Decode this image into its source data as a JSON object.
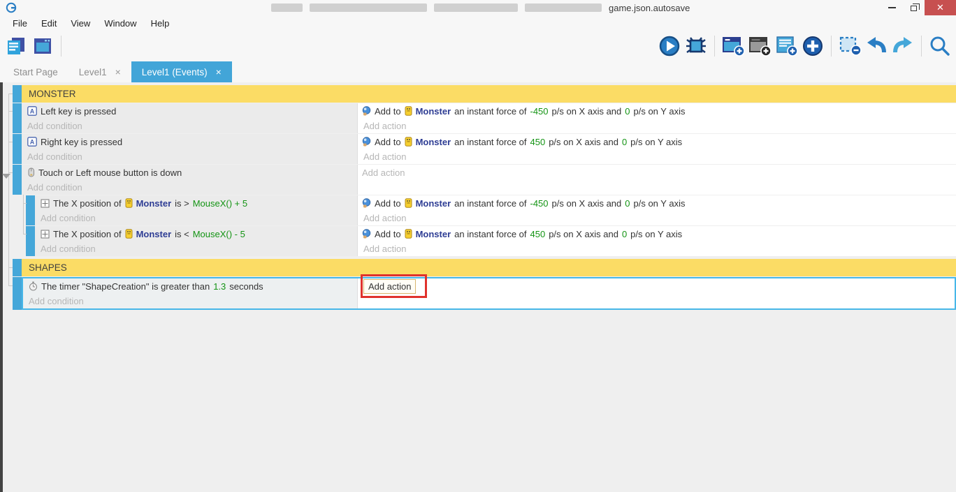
{
  "window": {
    "title": "game.json.autosave",
    "controls": {
      "minimize_glyph": "",
      "close_glyph": "✕"
    }
  },
  "menu": {
    "items": [
      "File",
      "Edit",
      "View",
      "Window",
      "Help"
    ]
  },
  "toolbar": {
    "left_icons": [
      "project-manager-icon",
      "scene-editor-icon"
    ],
    "right_icons": [
      "play-icon",
      "debug-icon",
      "add-event-icon",
      "add-subevent-icon",
      "add-comment-icon",
      "add-circle-icon",
      "remove-event-icon",
      "undo-icon",
      "redo-icon",
      "search-icon"
    ]
  },
  "tabs": {
    "items": [
      {
        "label": "Start Page",
        "active": false,
        "closable": false
      },
      {
        "label": "Level1",
        "active": false,
        "closable": true
      },
      {
        "label": "Level1 (Events)",
        "active": true,
        "closable": true
      }
    ],
    "close_glyph": "×"
  },
  "placeholders": {
    "condition": "Add condition",
    "action": "Add action"
  },
  "colors": {
    "accent_blue": "#42a5d8",
    "event_bar_blue": "#45a7d9",
    "group_yellow": "#fbdc65",
    "expression_green": "#149414",
    "object_navy": "#2e3d94",
    "annotation_red": "#e0322c",
    "close_button_red": "#c75050",
    "selected_border": "#47b7e8"
  },
  "events": {
    "group_monster": "MONSTER",
    "group_shapes": "SHAPES",
    "e1": {
      "cond": "Left key is pressed",
      "act_pre": "Add to",
      "act_obj": "Monster",
      "act_mid": "an instant force of",
      "act_v1": "-450",
      "act_mid2": "p/s on X axis and",
      "act_v2": "0",
      "act_suf": "p/s on Y axis"
    },
    "e2": {
      "cond": "Right key is pressed",
      "act_pre": "Add to",
      "act_obj": "Monster",
      "act_mid": "an instant force of",
      "act_v1": "450",
      "act_mid2": "p/s on X axis and",
      "act_v2": "0",
      "act_suf": "p/s on Y axis"
    },
    "e3": {
      "cond": "Touch or Left mouse button is down"
    },
    "s1": {
      "cond_pre": "The X position of",
      "cond_obj": "Monster",
      "cond_mid": "is >",
      "cond_expr": "MouseX() + 5",
      "act_pre": "Add to",
      "act_obj": "Monster",
      "act_mid": "an instant force of",
      "act_v1": "-450",
      "act_mid2": "p/s on X axis and",
      "act_v2": "0",
      "act_suf": "p/s on Y axis"
    },
    "s2": {
      "cond_pre": "The X position of",
      "cond_obj": "Monster",
      "cond_mid": "is <",
      "cond_expr": "MouseX() - 5",
      "act_pre": "Add to",
      "act_obj": "Monster",
      "act_mid": "an instant force of",
      "act_v1": "450",
      "act_mid2": "p/s on X axis and",
      "act_v2": "0",
      "act_suf": "p/s on Y axis"
    },
    "t1": {
      "cond_pre": "The timer \"ShapeCreation\" is greater than",
      "cond_v": "1.3",
      "cond_suf": "seconds",
      "act_focus": "Add action"
    }
  }
}
